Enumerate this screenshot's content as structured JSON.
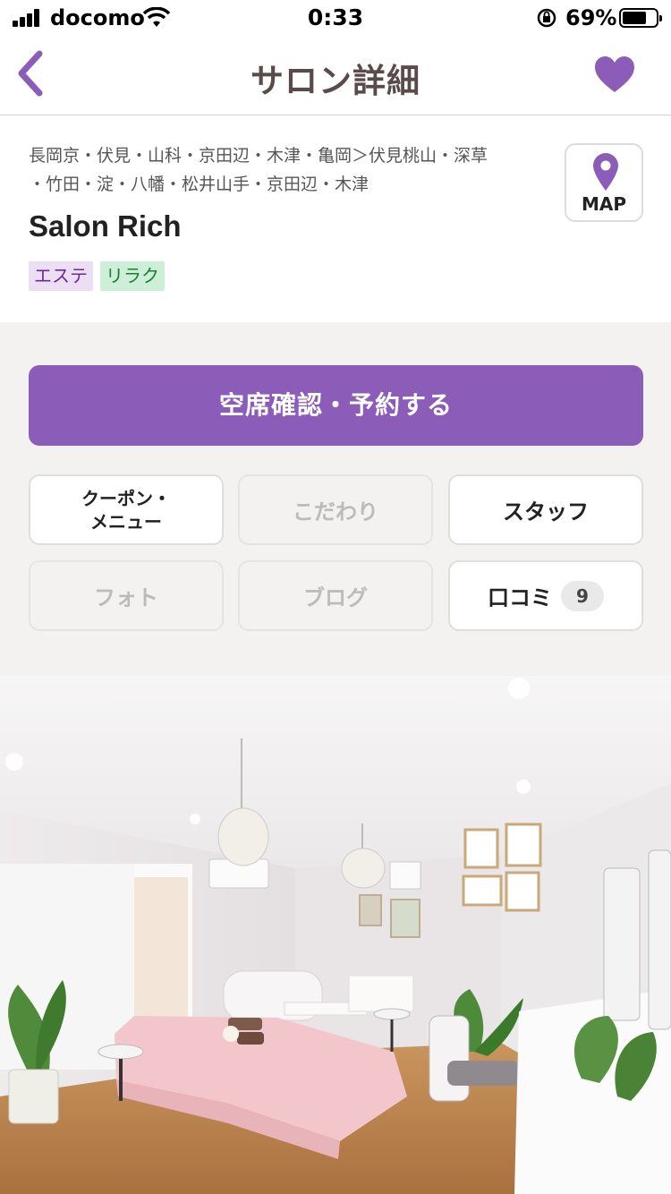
{
  "status_bar": {
    "carrier": "docomo",
    "time": "0:33",
    "battery_percent": "69%",
    "battery_level": 0.69
  },
  "nav": {
    "title": "サロン詳細",
    "back_icon": "chevron-left-icon",
    "favorite_icon": "heart-icon"
  },
  "salon": {
    "areas_line1": "長岡京・伏見・山科・京田辺・木津・亀岡＞伏見桃山・深草",
    "areas_line2": "・竹田・淀・八幡・松井山手・京田辺・木津",
    "name": "Salon Rich",
    "tags": [
      "エステ",
      "リラク"
    ],
    "map_label": "MAP"
  },
  "actions": {
    "reserve_label": "空席確認・予約する",
    "buttons": [
      {
        "label_line1": "クーポン・",
        "label_line2": "メニュー",
        "enabled": true
      },
      {
        "label": "こだわり",
        "enabled": false
      },
      {
        "label": "スタッフ",
        "enabled": true
      },
      {
        "label": "フォト",
        "enabled": false
      },
      {
        "label": "ブログ",
        "enabled": false
      },
      {
        "label": "口コミ",
        "count": "9",
        "enabled": true
      }
    ]
  },
  "colors": {
    "accent": "#8c5db8",
    "tag_este_bg": "#ecdff5",
    "tag_relax_bg": "#cdeed7"
  }
}
